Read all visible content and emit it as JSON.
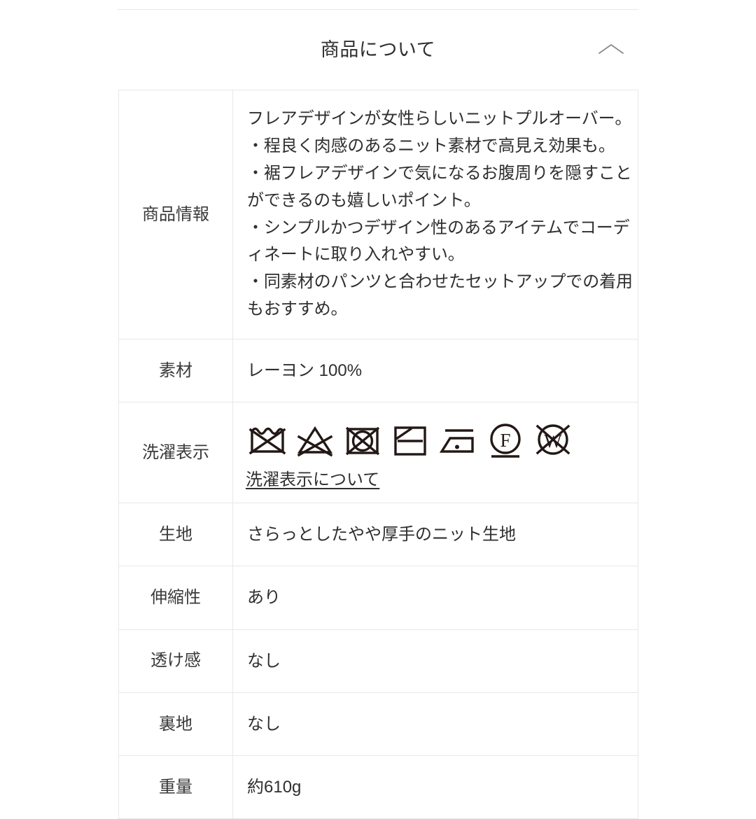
{
  "section": {
    "title": "商品について",
    "toggle_icon": "chevron-up-icon",
    "toggle_state": "expanded"
  },
  "colors": {
    "text": "#2f2f2f",
    "label_text": "#3a3a3a",
    "border": "#e8e8e8",
    "rule": "#e6e6e6",
    "chevron": "#8a8a8a",
    "symbol": "#231815",
    "background": "#ffffff"
  },
  "table": {
    "rows": [
      {
        "label": "商品情報",
        "value": "フレアデザインが女性らしいニットプルオーバー。\n・程良く肉感のあるニット素材で高見え効果も。\n・裾フレアデザインで気になるお腹周りを隠すことができるのも嬉しいポイント。\n・シンプルかつデザイン性のあるアイテムでコーディネートに取り入れやすい。\n・同素材のパンツと合わせたセットアップでの着用もおすすめ。"
      },
      {
        "label": "素材",
        "value": "レーヨン 100%"
      },
      {
        "label": "洗濯表示",
        "value": "",
        "care_link": "洗濯表示について",
        "care_symbols": [
          {
            "name": "do-not-wash-icon",
            "meaning": "洗濯処理禁止"
          },
          {
            "name": "do-not-bleach-icon",
            "meaning": "漂白処理禁止"
          },
          {
            "name": "do-not-tumble-dry-icon",
            "meaning": "タンブル乾燥禁止"
          },
          {
            "name": "flat-dry-in-shade-icon",
            "meaning": "日陰での平干し"
          },
          {
            "name": "iron-low-temperature-icon",
            "meaning": "底面温度110℃を限度としたアイロン仕上げ"
          },
          {
            "name": "dry-clean-petroleum-solvent-mild-icon",
            "meaning": "石油系溶剤による弱いドライクリーニング"
          },
          {
            "name": "do-not-wet-clean-icon",
            "meaning": "ウエットクリーニング禁止"
          }
        ]
      },
      {
        "label": "生地",
        "value": "さらっとしたやや厚手のニット生地"
      },
      {
        "label": "伸縮性",
        "value": "あり"
      },
      {
        "label": "透け感",
        "value": "なし"
      },
      {
        "label": "裏地",
        "value": "なし"
      },
      {
        "label": "重量",
        "value": "約610g"
      }
    ]
  }
}
